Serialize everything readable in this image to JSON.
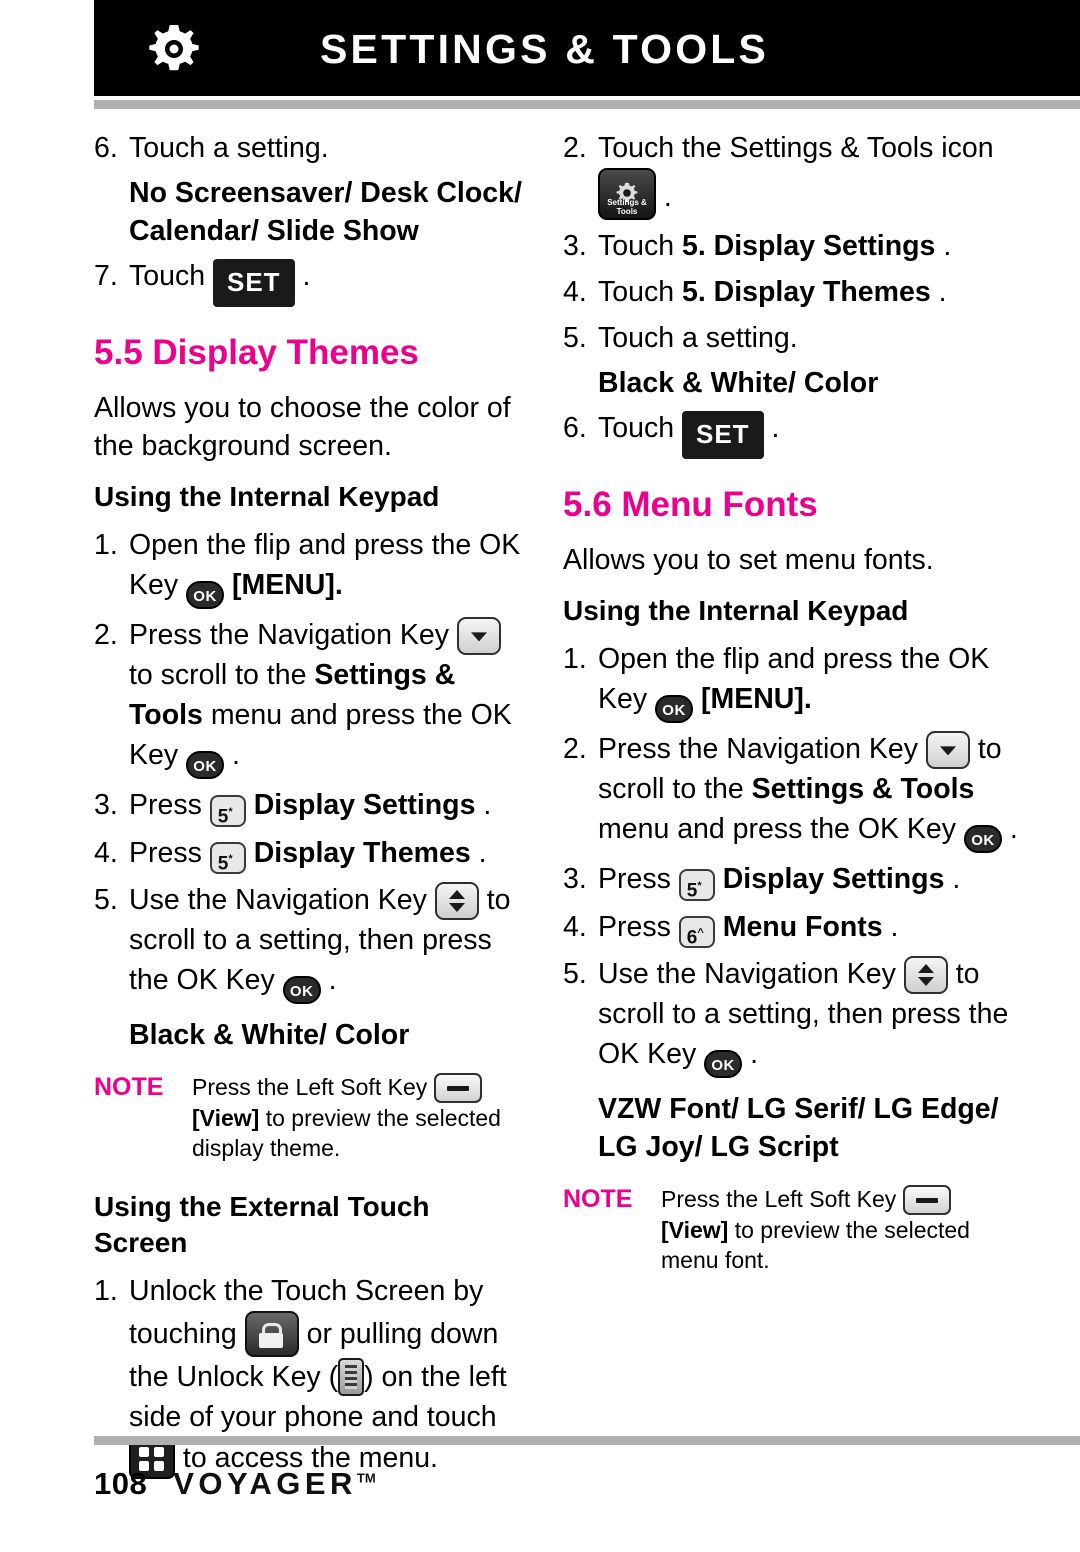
{
  "header": {
    "title": "SETTINGS & TOOLS",
    "icon": "gear-icon"
  },
  "left_column": {
    "step6": {
      "num": "6.",
      "text": "Touch a setting."
    },
    "options1": "No Screensaver/ Desk Clock/ Calendar/ Slide Show",
    "step7": {
      "num": "7.",
      "text_before": "Touch",
      "key": "SET",
      "text_after": "."
    },
    "section_55": "5.5 Display Themes",
    "section_55_desc": "Allows you to choose the color of the background screen.",
    "sub_internal_keypad": "Using the Internal Keypad",
    "k1": {
      "num": "1.",
      "a": "Open the flip and press the OK Key",
      "key": "OK",
      "b": "[MENU]."
    },
    "k2": {
      "num": "2.",
      "a": "Press the Navigation Key",
      "key1": "nav-down-key",
      "b": "to scroll to the",
      "bold": "Settings & Tools",
      "c": "menu and press the OK Key",
      "key2": "OK",
      "d": "."
    },
    "k3": {
      "num": "3.",
      "a": "Press",
      "key": "5",
      "bold": "Display Settings",
      "b": "."
    },
    "k4": {
      "num": "4.",
      "a": "Press",
      "key": "5",
      "bold": "Display Themes",
      "b": "."
    },
    "k5": {
      "num": "5.",
      "a": "Use the Navigation Key",
      "key1": "nav-up-down-key",
      "b": "to scroll to a setting, then press the OK Key",
      "key2": "OK",
      "c": "."
    },
    "options2": "Black & White/ Color",
    "note": {
      "label": "NOTE",
      "line1_a": "Press the Left Soft Key",
      "line1_key": "soft-key",
      "line2_bold": "[View]",
      "line2_a": "to preview the selected display theme."
    },
    "sub_external_touch": "Using the External Touch Screen",
    "t1": {
      "num": "1.",
      "a": "Unlock the Touch Screen by touching",
      "key_lock": "lock-key",
      "b": "or pulling down the Unlock Key (",
      "key_unlock": "unlock-slider-key",
      "c": ") on the left side of your phone and touch",
      "key_grid": "menu-grid-key",
      "d": "to access the menu."
    }
  },
  "right_column": {
    "t2": {
      "num": "2.",
      "a": "Touch the Settings & Tools icon",
      "key": "settings-tools-icon",
      "b": "."
    },
    "t3": {
      "num": "3.",
      "a": "Touch",
      "bold": "5. Display Settings",
      "b": "."
    },
    "t4": {
      "num": "4.",
      "a": "Touch",
      "bold": "5. Display Themes",
      "b": "."
    },
    "t5": {
      "num": "5.",
      "a": "Touch a setting."
    },
    "options1": "Black & White/ Color",
    "t6": {
      "num": "6.",
      "a": "Touch",
      "key": "SET",
      "b": "."
    },
    "section_56": "5.6 Menu Fonts",
    "section_56_desc": "Allows you to set menu fonts.",
    "sub_internal_keypad": "Using the Internal Keypad",
    "k1": {
      "num": "1.",
      "a": "Open the flip and press the OK Key",
      "key": "OK",
      "b": "[MENU]."
    },
    "k2": {
      "num": "2.",
      "a": "Press the Navigation Key",
      "key1": "nav-down-key",
      "b": "to scroll to the",
      "bold": "Settings & Tools",
      "c": "menu and press the OK Key",
      "key2": "OK",
      "d": "."
    },
    "k3": {
      "num": "3.",
      "a": "Press",
      "key": "5",
      "bold": "Display Settings",
      "b": "."
    },
    "k4": {
      "num": "4.",
      "a": "Press",
      "key": "6",
      "bold": "Menu Fonts",
      "b": "."
    },
    "k5": {
      "num": "5.",
      "a": "Use the Navigation Key",
      "key1": "nav-up-down-key",
      "b": "to scroll to a setting, then press the OK Key",
      "key2": "OK",
      "c": "."
    },
    "options2": "VZW Font/ LG Serif/ LG Edge/ LG Joy/ LG Script",
    "note": {
      "label": "NOTE",
      "line1_a": "Press the Left Soft Key",
      "line1_key": "soft-key",
      "line2_bold": "[View]",
      "line2_a": "to preview the selected menu font."
    }
  },
  "footer": {
    "page_number": "108",
    "brand": "VOYAGER",
    "brand_tm": "TM"
  },
  "colors": {
    "accent_pink": "#ec008c",
    "header_black": "#000000",
    "rule_gray": "#b0b0b0"
  },
  "keys": {
    "set": "SET",
    "ok": "OK",
    "five": "5",
    "six": "6",
    "settings_tools_label1": "Settings &",
    "settings_tools_label2": "Tools"
  }
}
